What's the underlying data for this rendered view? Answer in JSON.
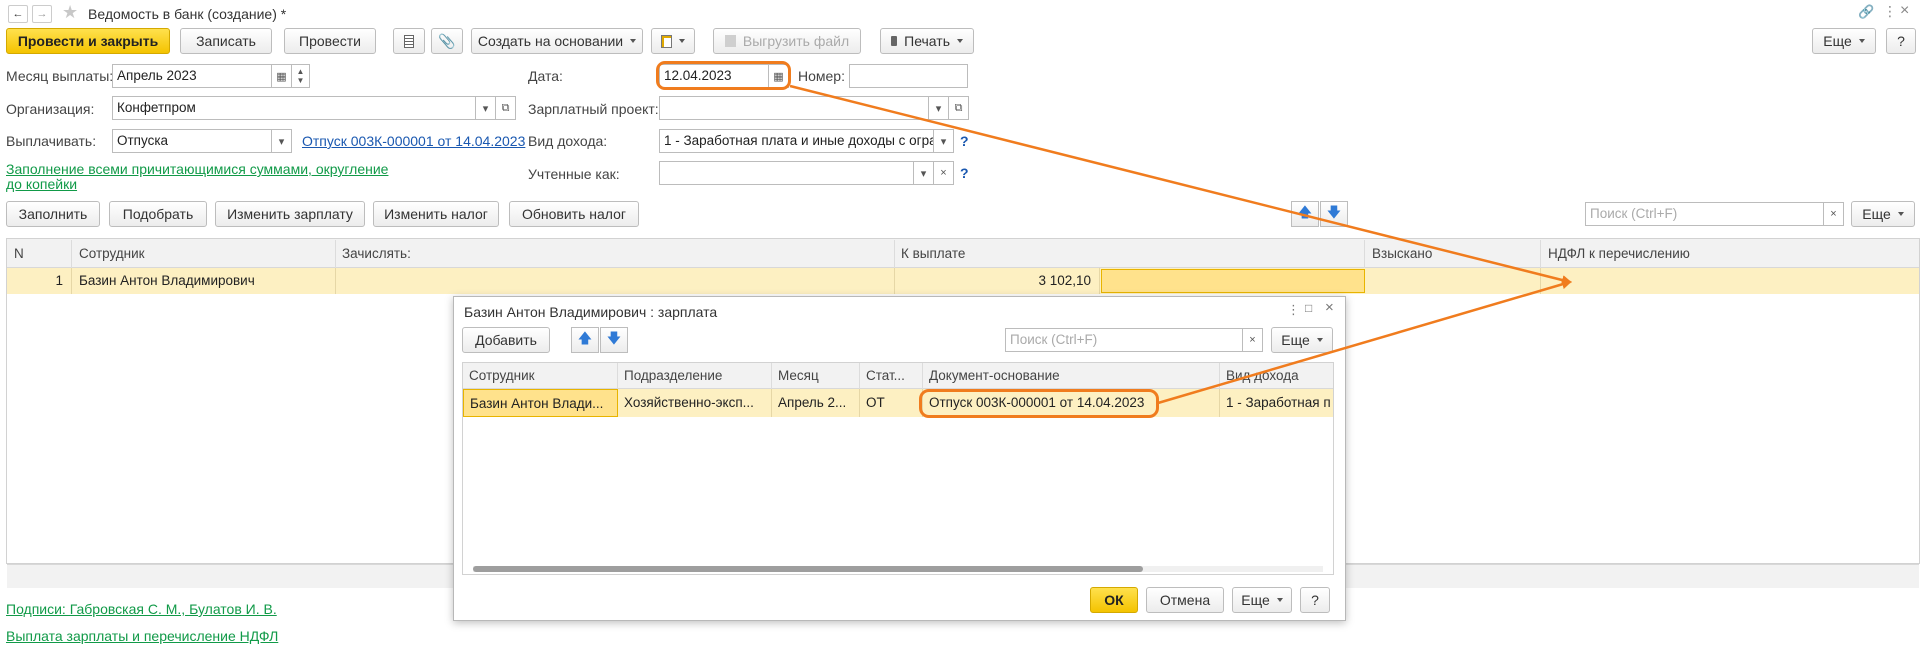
{
  "window": {
    "title": "Ведомость в банк (создание) *"
  },
  "toolbar": {
    "post_close": "Провести и закрыть",
    "save": "Записать",
    "post": "Провести",
    "create_based": "Создать на основании",
    "export_file": "Выгрузить файл",
    "print": "Печать",
    "more": "Еще",
    "help": "?"
  },
  "form": {
    "month_label": "Месяц выплаты:",
    "month_value": "Апрель 2023",
    "org_label": "Организация:",
    "org_value": "Конфетпром",
    "pay_label": "Выплачивать:",
    "pay_value": "Отпуска",
    "pay_link": "Отпуск 003К-000001 от 14.04.2023",
    "fill_link": "Заполнение всеми причитающимися суммами, округление до копейки",
    "date_label": "Дата:",
    "date_value": "12.04.2023",
    "number_label": "Номер:",
    "number_value": "",
    "salary_project_label": "Зарплатный проект:",
    "salary_project_value": "",
    "income_label": "Вид дохода:",
    "income_value": "1 - Заработная плата и иные доходы с огра",
    "counted_label": "Учтенные как:",
    "counted_value": "",
    "help": "?"
  },
  "table_toolbar": {
    "fill": "Заполнить",
    "select": "Подобрать",
    "change_salary": "Изменить зарплату",
    "change_tax": "Изменить налог",
    "update_tax": "Обновить налог",
    "search_placeholder": "Поиск (Ctrl+F)",
    "more": "Еще"
  },
  "table": {
    "headers": [
      "N",
      "Сотрудник",
      "Зачислять:",
      "К выплате",
      "Взыскано",
      "НДФЛ к перечислению"
    ],
    "rows": [
      {
        "n": "1",
        "employee": "Базин Антон Владимирович",
        "credit": "",
        "to_pay": "3 102,10",
        "withheld": "",
        "ndfl": ""
      }
    ]
  },
  "footer": {
    "signatures_link": "Подписи: Габровская С. М., Булатов И. В.",
    "payment_link": "Выплата зарплаты и перечисление НДФЛ"
  },
  "dialog": {
    "title": "Базин Антон Владимирович : зарплата",
    "add": "Добавить",
    "search_placeholder": "Поиск (Ctrl+F)",
    "more": "Еще",
    "headers": [
      "Сотрудник",
      "Подразделение",
      "Месяц",
      "Стат...",
      "Документ-основание",
      "Вид дохода"
    ],
    "rows": [
      {
        "employee": "Базин Антон Влади...",
        "department": "Хозяйственно-эксп...",
        "month": "Апрель 2...",
        "status": "ОТ",
        "document": "Отпуск 003К-000001 от 14.04.2023",
        "income": "1 - Заработная п"
      }
    ],
    "ok": "ОК",
    "cancel": "Отмена",
    "help": "?"
  },
  "colors": {
    "accent_yellow": "#f4c300",
    "selection_row": "#fdf0c2",
    "annotation_orange": "#f07c1e",
    "link_blue": "#1a58b0",
    "link_green": "#119a48"
  }
}
